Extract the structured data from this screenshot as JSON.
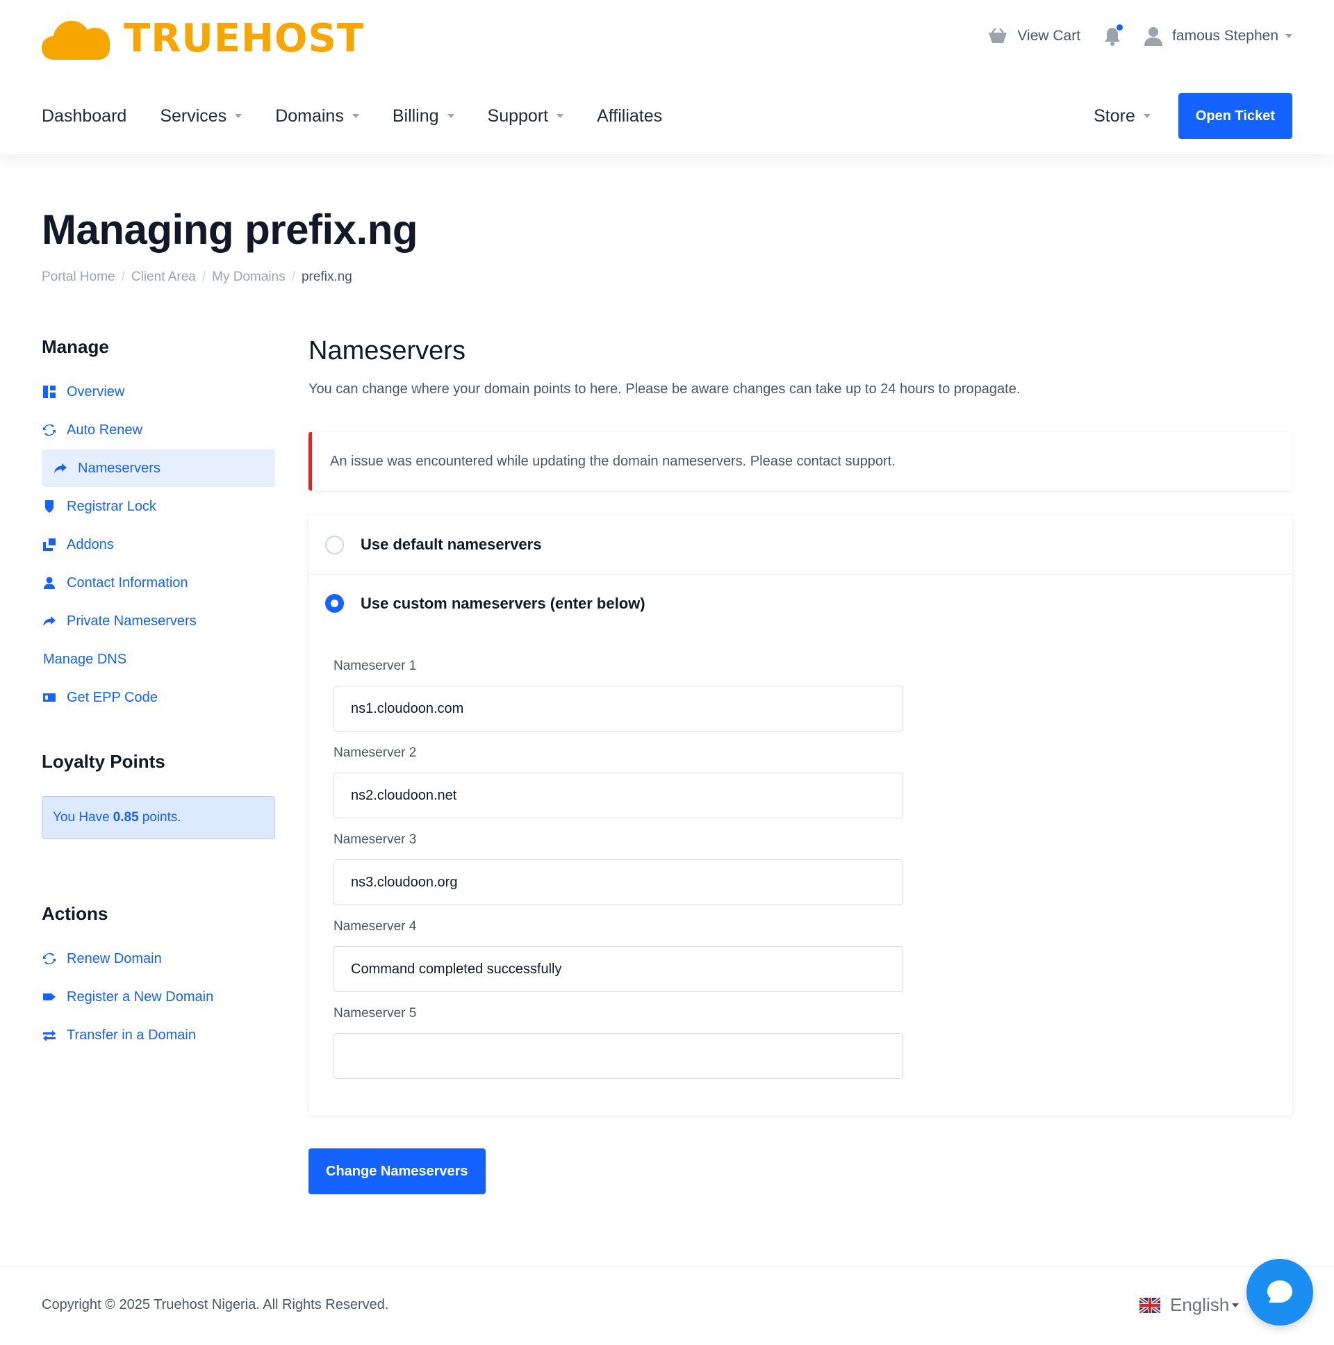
{
  "brand": {
    "name": "TRUEHOST",
    "color": "#f7a600"
  },
  "top_right": {
    "cart_label": "View Cart",
    "user_name": "famous Stephen"
  },
  "nav": {
    "items": [
      {
        "label": "Dashboard",
        "has_dropdown": false
      },
      {
        "label": "Services",
        "has_dropdown": true
      },
      {
        "label": "Domains",
        "has_dropdown": true
      },
      {
        "label": "Billing",
        "has_dropdown": true
      },
      {
        "label": "Support",
        "has_dropdown": true
      },
      {
        "label": "Affiliates",
        "has_dropdown": false
      }
    ],
    "store_label": "Store",
    "open_ticket_label": "Open Ticket"
  },
  "page": {
    "title": "Managing prefix.ng",
    "breadcrumb": [
      "Portal Home",
      "Client Area",
      "My Domains",
      "prefix.ng"
    ]
  },
  "sidebar": {
    "manage_heading": "Manage",
    "manage_items": [
      {
        "label": "Overview",
        "icon": "overview-icon",
        "active": false
      },
      {
        "label": "Auto Renew",
        "icon": "sync-icon",
        "active": false
      },
      {
        "label": "Nameservers",
        "icon": "share-arrow-icon",
        "active": true
      },
      {
        "label": "Registrar Lock",
        "icon": "shield-icon",
        "active": false
      },
      {
        "label": "Addons",
        "icon": "cubes-icon",
        "active": false
      },
      {
        "label": "Contact Information",
        "icon": "user-icon",
        "active": false
      },
      {
        "label": "Private Nameservers",
        "icon": "share-arrow-icon",
        "active": false
      },
      {
        "label": "Manage DNS",
        "icon": "",
        "active": false
      },
      {
        "label": "Get EPP Code",
        "icon": "id-card-icon",
        "active": false
      }
    ],
    "loyalty_heading": "Loyalty Points",
    "loyalty_prefix": "You Have",
    "loyalty_points": "0.85",
    "loyalty_suffix": "points.",
    "actions_heading": "Actions",
    "actions_items": [
      {
        "label": "Renew Domain",
        "icon": "sync-icon"
      },
      {
        "label": "Register a New Domain",
        "icon": "tag-icon"
      },
      {
        "label": "Transfer in a Domain",
        "icon": "exchange-icon"
      }
    ]
  },
  "main": {
    "heading": "Nameservers",
    "description": "You can change where your domain points to here. Please be aware changes can take up to 24 hours to propagate.",
    "alert": "An issue was encountered while updating the domain nameservers. Please contact support.",
    "option_default": "Use default nameservers",
    "option_custom": "Use custom nameservers (enter below)",
    "selected_option": "custom",
    "nameservers": [
      {
        "label": "Nameserver 1",
        "value": "ns1.cloudoon.com"
      },
      {
        "label": "Nameserver 2",
        "value": "ns2.cloudoon.net"
      },
      {
        "label": "Nameserver 3",
        "value": "ns3.cloudoon.org"
      },
      {
        "label": "Nameserver 4",
        "value": "Command completed successfully"
      },
      {
        "label": "Nameserver 5",
        "value": ""
      }
    ],
    "submit_label": "Change Nameservers"
  },
  "footer": {
    "copyright": "Copyright © 2025 Truehost Nigeria. All Rights Reserved.",
    "language": "English"
  },
  "colors": {
    "accent": "#1462ff",
    "alert_border": "#dc2626",
    "chat": "#1b8ef2"
  }
}
